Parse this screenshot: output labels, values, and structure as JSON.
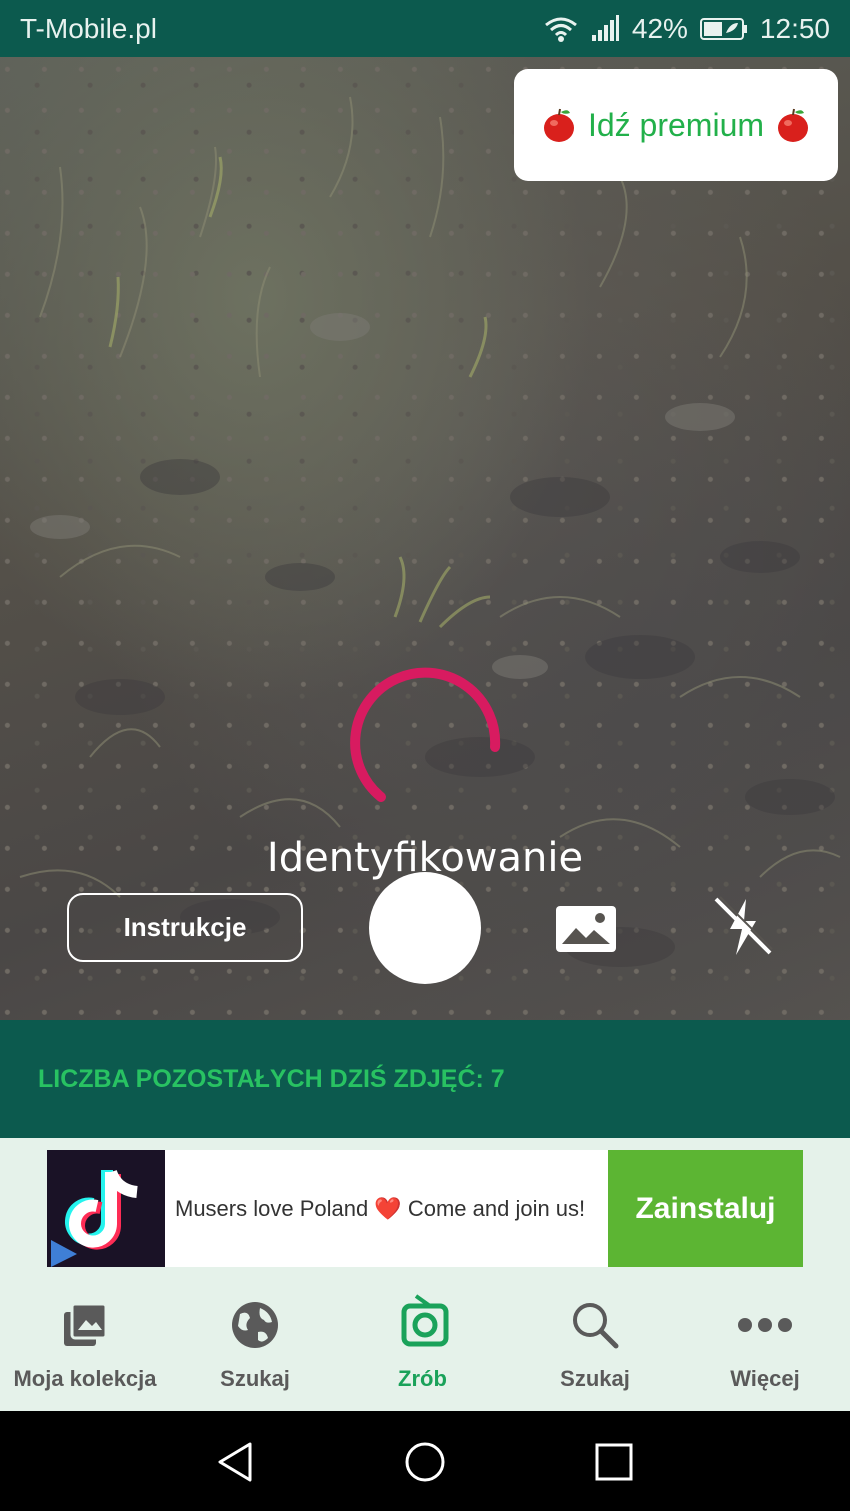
{
  "status_bar": {
    "carrier": "T-Mobile.pl",
    "battery": "42%",
    "time": "12:50"
  },
  "camera": {
    "premium_label": "Idź premium",
    "status_text": "Identyfikowanie",
    "instructions_label": "Instrukcje",
    "spinner_color": "#d81b60"
  },
  "remaining_banner": {
    "text": "LICZBA POZOSTAŁYCH DZIŚ ZDJĘĆ: 7"
  },
  "ad": {
    "message": "Musers love Poland ❤️ Come and join us!",
    "install_label": "Zainstaluj"
  },
  "bottom_nav": {
    "items": [
      {
        "label": "Moja kolekcja",
        "icon": "collection-icon"
      },
      {
        "label": "Szukaj",
        "icon": "globe-icon"
      },
      {
        "label": "Zrób",
        "icon": "camera-icon",
        "active": true
      },
      {
        "label": "Szukaj",
        "icon": "search-icon"
      },
      {
        "label": "Więcej",
        "icon": "more-icon"
      }
    ]
  },
  "colors": {
    "brand_dark": "#0c5a4e",
    "brand_green": "#28c262",
    "nav_active": "#1aa25a"
  }
}
